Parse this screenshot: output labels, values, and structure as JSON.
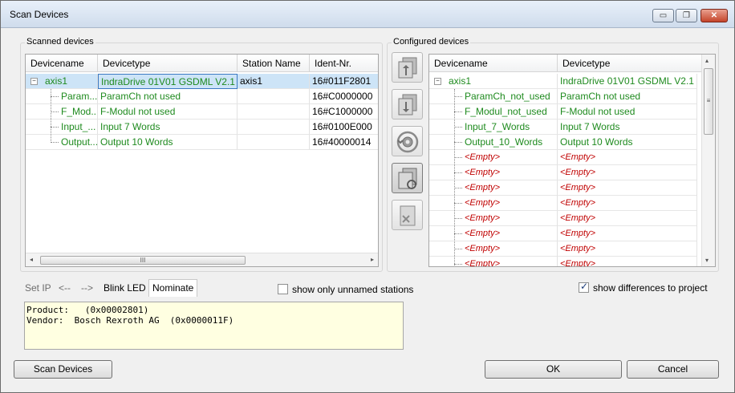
{
  "window": {
    "title": "Scan Devices",
    "min_glyph": "▭",
    "max_glyph": "❐",
    "close_glyph": "✕"
  },
  "scanned": {
    "group_label": "Scanned devices",
    "columns": [
      "Devicename",
      "Devicetype",
      "Station Name",
      "Ident-Nr."
    ],
    "rows": [
      {
        "name": "axis1",
        "type": "IndraDrive 01V01 GSDML V2.1",
        "station": "axis1",
        "ident": "16#011F2801"
      },
      {
        "name": "Param...",
        "type": "ParamCh not used",
        "station": "",
        "ident": "16#C0000000"
      },
      {
        "name": "F_Mod...",
        "type": "F-Modul not used",
        "station": "",
        "ident": "16#C1000000"
      },
      {
        "name": "Input_...",
        "type": "Input 7 Words",
        "station": "",
        "ident": "16#0100E000"
      },
      {
        "name": "Output...",
        "type": "Output 10 Words",
        "station": "",
        "ident": "16#40000014"
      }
    ],
    "expand_glyph": "−",
    "scroll_left": "◂",
    "scroll_right": "▸",
    "scroll_grip": "III"
  },
  "configured": {
    "group_label": "Configured devices",
    "columns": [
      "Devicename",
      "Devicetype"
    ],
    "rows": [
      {
        "name": "axis1",
        "type": "IndraDrive 01V01 GSDML V2.1"
      },
      {
        "name": "ParamCh_not_used",
        "type": "ParamCh not used"
      },
      {
        "name": "F_Modul_not_used",
        "type": "F-Modul not used"
      },
      {
        "name": "Input_7_Words",
        "type": "Input 7 Words"
      },
      {
        "name": "Output_10_Words",
        "type": "Output 10 Words"
      },
      {
        "name": "<Empty>",
        "type": "<Empty>"
      },
      {
        "name": "<Empty>",
        "type": "<Empty>"
      },
      {
        "name": "<Empty>",
        "type": "<Empty>"
      },
      {
        "name": "<Empty>",
        "type": "<Empty>"
      },
      {
        "name": "<Empty>",
        "type": "<Empty>"
      },
      {
        "name": "<Empty>",
        "type": "<Empty>"
      },
      {
        "name": "<Empty>",
        "type": "<Empty>"
      },
      {
        "name": "<Empty>",
        "type": "<Empty>"
      }
    ],
    "scroll_up": "▴",
    "scroll_down": "▾",
    "scroll_grip": "≡"
  },
  "tabs": [
    {
      "label": "Set IP",
      "state": "disabled"
    },
    {
      "label": "<--",
      "state": "disabled"
    },
    {
      "label": "-->",
      "state": "disabled"
    },
    {
      "label": "Blink LED",
      "state": "normal"
    },
    {
      "label": "Nominate",
      "state": "selected"
    }
  ],
  "options": {
    "unnamed_label": "show only unnamed stations",
    "unnamed_checked": false,
    "differences_label": "show differences to project",
    "differences_checked": true,
    "check_glyph": "✓"
  },
  "info": {
    "line1": "Product:   (0x00002801)",
    "line2": "Vendor:  Bosch Rexroth AG  (0x0000011F)"
  },
  "buttons": {
    "scan": "Scan Devices",
    "ok": "OK",
    "cancel": "Cancel"
  }
}
